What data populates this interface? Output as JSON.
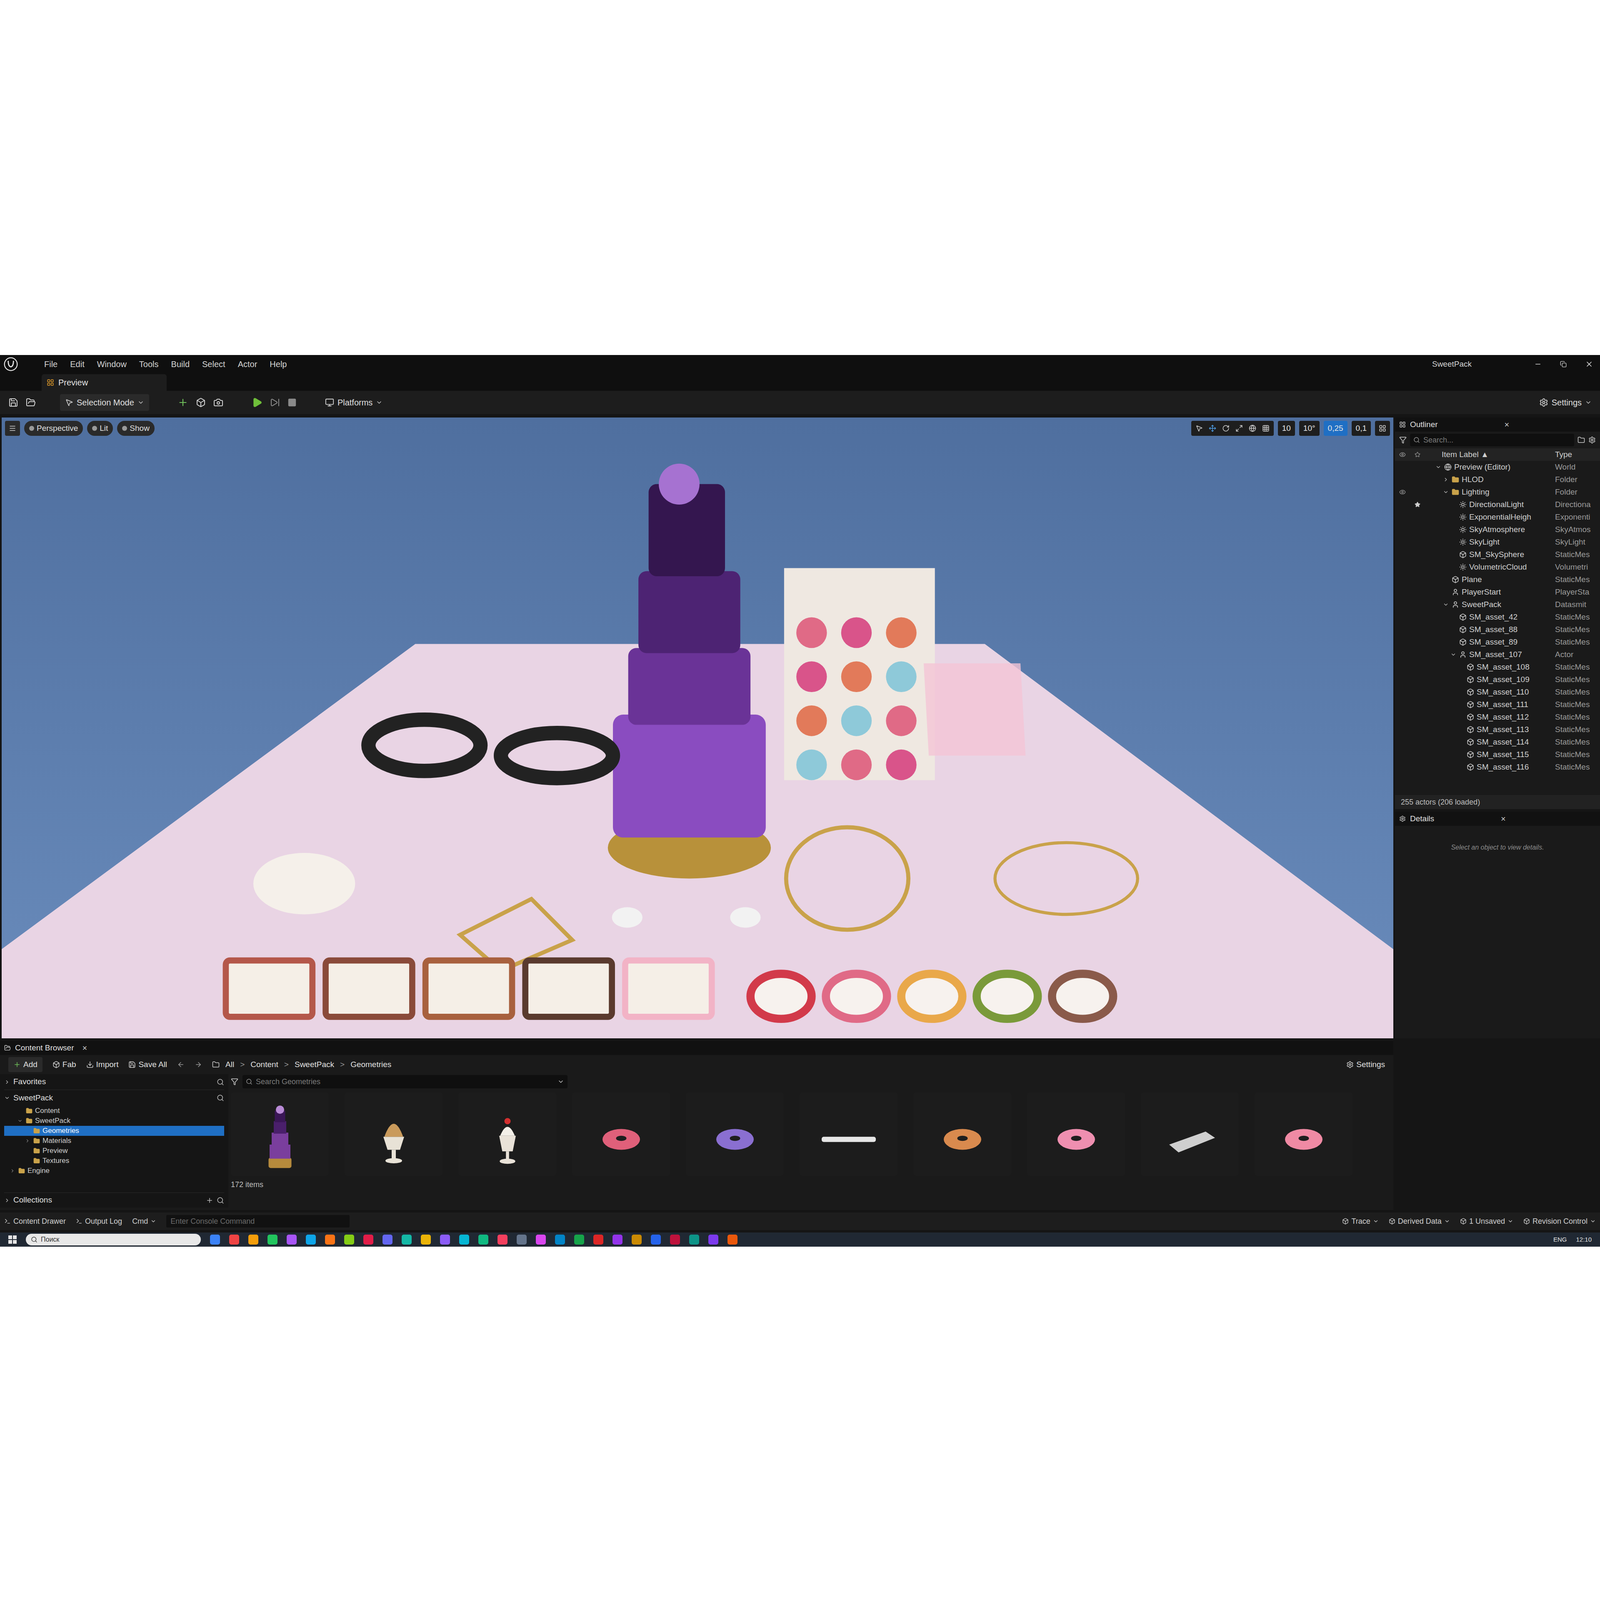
{
  "window": {
    "title": "SweetPack",
    "minimize": "–",
    "close": "×"
  },
  "menu": [
    "File",
    "Edit",
    "Window",
    "Tools",
    "Build",
    "Select",
    "Actor",
    "Help"
  ],
  "level_tab": {
    "label": "Preview"
  },
  "toolbar": {
    "mode": "Selection Mode",
    "platforms": "Platforms",
    "settings": "Settings"
  },
  "viewport": {
    "buttons": [
      "Perspective",
      "Lit",
      "Show"
    ],
    "snaps": [
      {
        "value": "10",
        "selected": false
      },
      {
        "value": "10°",
        "selected": false
      },
      {
        "value": "0,25",
        "selected": true
      },
      {
        "value": "0,1",
        "selected": false
      }
    ]
  },
  "outliner": {
    "title": "Outliner",
    "close": "×",
    "search_placeholder": "Search...",
    "columns": [
      "Item Label ▲",
      "Type"
    ],
    "rows": [
      {
        "label": "Preview (Editor)",
        "type": "World",
        "depth": 1,
        "expandable": true,
        "expanded": true,
        "kind": "world",
        "visible": false,
        "pinned": false
      },
      {
        "label": "HLOD",
        "type": "Folder",
        "depth": 2,
        "expandable": true,
        "expanded": false,
        "kind": "folder",
        "visible": false,
        "pinned": false
      },
      {
        "label": "Lighting",
        "type": "Folder",
        "depth": 2,
        "expandable": true,
        "expanded": true,
        "kind": "folder",
        "visible": true,
        "pinned": false
      },
      {
        "label": "DirectionalLight",
        "type": "Directiona",
        "depth": 3,
        "expandable": false,
        "expanded": false,
        "kind": "light",
        "visible": false,
        "pinned": true
      },
      {
        "label": "ExponentialHeigh",
        "type": "Exponenti",
        "depth": 3,
        "expandable": false,
        "expanded": false,
        "kind": "light",
        "visible": false,
        "pinned": false
      },
      {
        "label": "SkyAtmosphere",
        "type": "SkyAtmos",
        "depth": 3,
        "expandable": false,
        "expanded": false,
        "kind": "light",
        "visible": false,
        "pinned": false
      },
      {
        "label": "SkyLight",
        "type": "SkyLight",
        "depth": 3,
        "expandable": false,
        "expanded": false,
        "kind": "light",
        "visible": false,
        "pinned": false
      },
      {
        "label": "SM_SkySphere",
        "type": "StaticMes",
        "depth": 3,
        "expandable": false,
        "expanded": false,
        "kind": "mesh",
        "visible": false,
        "pinned": false
      },
      {
        "label": "VolumetricCloud",
        "type": "Volumetri",
        "depth": 3,
        "expandable": false,
        "expanded": false,
        "kind": "light",
        "visible": false,
        "pinned": false
      },
      {
        "label": "Plane",
        "type": "StaticMes",
        "depth": 2,
        "expandable": false,
        "expanded": false,
        "kind": "mesh",
        "visible": false,
        "pinned": false
      },
      {
        "label": "PlayerStart",
        "type": "PlayerSta",
        "depth": 2,
        "expandable": false,
        "expanded": false,
        "kind": "actor",
        "visible": false,
        "pinned": false
      },
      {
        "label": "SweetPack",
        "type": "Datasmit",
        "depth": 2,
        "expandable": true,
        "expanded": true,
        "kind": "actor",
        "visible": false,
        "pinned": false
      },
      {
        "label": "SM_asset_42",
        "type": "StaticMes",
        "depth": 3,
        "expandable": false,
        "expanded": false,
        "kind": "mesh",
        "visible": false,
        "pinned": false
      },
      {
        "label": "SM_asset_88",
        "type": "StaticMes",
        "depth": 3,
        "expandable": false,
        "expanded": false,
        "kind": "mesh",
        "visible": false,
        "pinned": false
      },
      {
        "label": "SM_asset_89",
        "type": "StaticMes",
        "depth": 3,
        "expandable": false,
        "expanded": false,
        "kind": "mesh",
        "visible": false,
        "pinned": false
      },
      {
        "label": "SM_asset_107",
        "type": "Actor",
        "depth": 3,
        "expandable": true,
        "expanded": true,
        "kind": "actor",
        "visible": false,
        "pinned": false
      },
      {
        "label": "SM_asset_108",
        "type": "StaticMes",
        "depth": 4,
        "expandable": false,
        "expanded": false,
        "kind": "mesh",
        "visible": false,
        "pinned": false
      },
      {
        "label": "SM_asset_109",
        "type": "StaticMes",
        "depth": 4,
        "expandable": false,
        "expanded": false,
        "kind": "mesh",
        "visible": false,
        "pinned": false
      },
      {
        "label": "SM_asset_110",
        "type": "StaticMes",
        "depth": 4,
        "expandable": false,
        "expanded": false,
        "kind": "mesh",
        "visible": false,
        "pinned": false
      },
      {
        "label": "SM_asset_111",
        "type": "StaticMes",
        "depth": 4,
        "expandable": false,
        "expanded": false,
        "kind": "mesh",
        "visible": false,
        "pinned": false
      },
      {
        "label": "SM_asset_112",
        "type": "StaticMes",
        "depth": 4,
        "expandable": false,
        "expanded": false,
        "kind": "mesh",
        "visible": false,
        "pinned": false
      },
      {
        "label": "SM_asset_113",
        "type": "StaticMes",
        "depth": 4,
        "expandable": false,
        "expanded": false,
        "kind": "mesh",
        "visible": false,
        "pinned": false
      },
      {
        "label": "SM_asset_114",
        "type": "StaticMes",
        "depth": 4,
        "expandable": false,
        "expanded": false,
        "kind": "mesh",
        "visible": false,
        "pinned": false
      },
      {
        "label": "SM_asset_115",
        "type": "StaticMes",
        "depth": 4,
        "expandable": false,
        "expanded": false,
        "kind": "mesh",
        "visible": false,
        "pinned": false
      },
      {
        "label": "SM_asset_116",
        "type": "StaticMes",
        "depth": 4,
        "expandable": false,
        "expanded": false,
        "kind": "mesh",
        "visible": false,
        "pinned": false
      }
    ],
    "footer": "255 actors (206 loaded)"
  },
  "details": {
    "title": "Details",
    "close": "×",
    "empty_message": "Select an object to view details."
  },
  "content_browser": {
    "title": "Content Browser",
    "close": "×",
    "buttons": [
      "Add",
      "Fab",
      "Import",
      "Save All"
    ],
    "breadcrumbs": [
      "All",
      "Content",
      "SweetPack",
      "Geometries"
    ],
    "separator": ">",
    "settings": "Settings",
    "favorites": "Favorites",
    "root": "SweetPack",
    "tree": [
      {
        "label": "Content",
        "depth": 1,
        "expandable": false,
        "expanded": false,
        "selected": false
      },
      {
        "label": "SweetPack",
        "depth": 1,
        "expandable": true,
        "expanded": true,
        "selected": false
      },
      {
        "label": "Geometries",
        "depth": 2,
        "expandable": false,
        "expanded": false,
        "selected": true
      },
      {
        "label": "Materials",
        "depth": 2,
        "expandable": true,
        "expanded": false,
        "selected": false
      },
      {
        "label": "Preview",
        "depth": 2,
        "expandable": false,
        "expanded": false,
        "selected": false
      },
      {
        "label": "Textures",
        "depth": 2,
        "expandable": false,
        "expanded": false,
        "selected": false
      },
      {
        "label": "Engine",
        "depth": 0,
        "expandable": true,
        "expanded": false,
        "selected": false
      }
    ],
    "collections": "Collections",
    "search_placeholder": "Search Geometries",
    "assets": [
      {
        "kind": "cake",
        "color": "#7a3e9d"
      },
      {
        "kind": "cup",
        "color": "#c99a5b"
      },
      {
        "kind": "sundae",
        "color": "#e9e2d8"
      },
      {
        "kind": "donut",
        "color": "#e0607a"
      },
      {
        "kind": "donut",
        "color": "#8a6fd1"
      },
      {
        "kind": "bar",
        "color": "#e6e6e6"
      },
      {
        "kind": "donut",
        "color": "#d98a4e"
      },
      {
        "kind": "donut",
        "color": "#ef8fb0"
      },
      {
        "kind": "tray",
        "color": "#cfcfcf"
      },
      {
        "kind": "donut",
        "color": "#f08aa4"
      }
    ],
    "count": "172 items"
  },
  "status_bar": {
    "left": [
      "Content Drawer",
      "Output Log"
    ],
    "cmd": "Cmd",
    "console_placeholder": "Enter Console Command",
    "right": [
      "Trace",
      "Derived Data",
      "1 Unsaved",
      "Revision Control"
    ]
  },
  "taskbar": {
    "search": "Поиск",
    "language": "ENG",
    "time": "12:10"
  }
}
